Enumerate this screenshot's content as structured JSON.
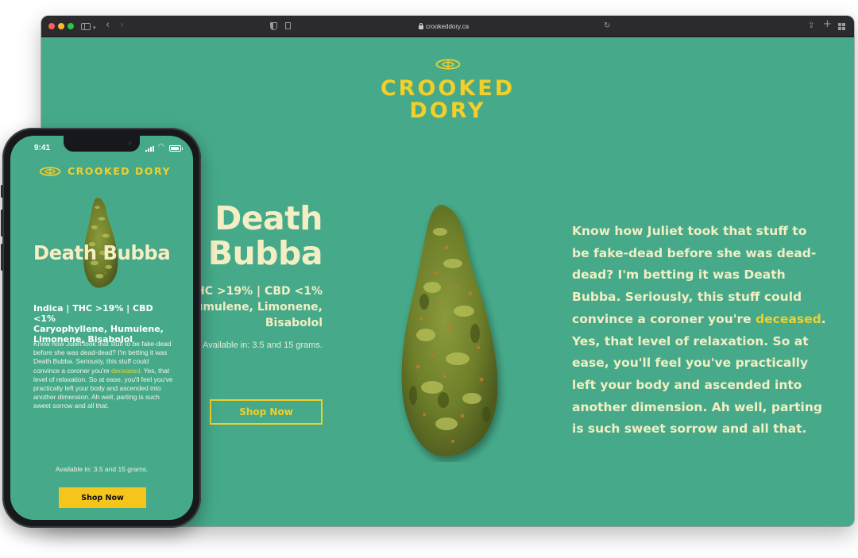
{
  "browser": {
    "url": "crookeddory.ca"
  },
  "site": {
    "brand_line1": "CROOKED",
    "brand_line2": "DORY",
    "product_line1": "Death",
    "product_line2": "Bubba",
    "specs_line1": "THC >19% | CBD <1%",
    "specs_line2": "Humulene, Limonene,",
    "specs_line3": "Bisabolol",
    "availability": "Available in: 3.5 and 15 grams.",
    "shop_button": "Shop Now",
    "description_pre": "Know how Juliet took that stuff to be fake-dead before she was dead-dead? I'm betting it was Death Bubba. Seriously, this stuff could convince a coroner you're ",
    "description_highlight": "deceased",
    "description_post": ". Yes, that level of relaxation. So at ease, you'll feel you've practically left your body and ascended into another dimension. Ah well, parting is such sweet sorrow and all that."
  },
  "phone": {
    "time": "9:41",
    "brand": "CROOKED DORY",
    "title": "Death Bubba",
    "specs_line1": "Indica | THC >19% | CBD <1%",
    "specs_line2": "Caryophyllene, Humulene,",
    "specs_line3": "Limonene, Bisabolol",
    "description_pre": "Know how Juliet took that stuff to be fake-dead before she was dead-dead? I'm betting it was Death Bubba. Seriously, this stuff could convince a coroner you're ",
    "description_highlight": "deceased",
    "description_post": ". Yes, that level of relaxation. So at ease, you'll feel you've practically left your body and ascended into another dimension. Ah well, parting is such sweet sorrow and all that.",
    "availability": "Available in: 3.5 and 15 grams.",
    "shop_button": "Shop Now"
  },
  "colors": {
    "background_green": "#46aa8a",
    "brand_yellow": "#f2cf2a",
    "cream_text": "#f3eec3",
    "button_yellow": "#f5c51c"
  }
}
